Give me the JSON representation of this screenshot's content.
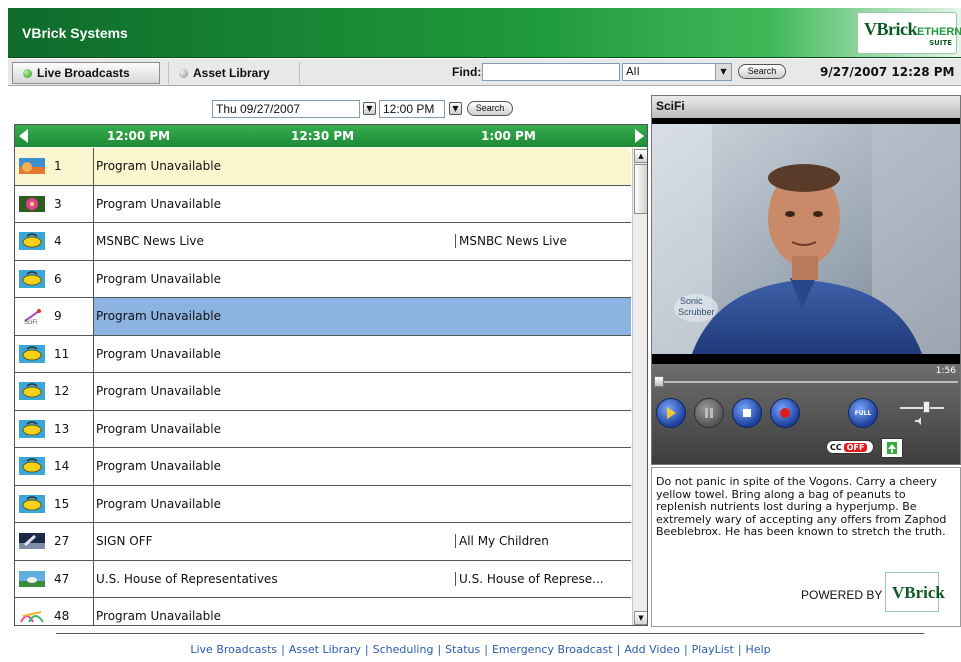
{
  "header": {
    "brand": "VBrick Systems",
    "logo_main": "VBrick",
    "logo_sub": "ETHERNETV",
    "logo_suite": "SUITE"
  },
  "nav": {
    "tabs": [
      {
        "label": "Live Broadcasts",
        "active": true
      },
      {
        "label": "Asset Library",
        "active": false
      }
    ],
    "find_label": "Find:",
    "find_value": "",
    "find_scope": "All",
    "search_button": "Search",
    "datetime": "9/27/2007 12:28 PM"
  },
  "guide": {
    "date": "Thu 09/27/2007",
    "time": "12:00 PM",
    "search_button": "Search",
    "time_slots": [
      "12:00 PM",
      "12:30 PM",
      "1:00 PM"
    ],
    "channels": [
      {
        "num": "1",
        "icon": "sunset-thumb-icon",
        "programs": [
          "Program Unavailable"
        ],
        "state": "highlight"
      },
      {
        "num": "3",
        "icon": "flower-thumb-icon",
        "programs": [
          "Program Unavailable"
        ],
        "state": ""
      },
      {
        "num": "4",
        "icon": "broadcast-icon",
        "programs": [
          "MSNBC News Live",
          "MSNBC News Live"
        ],
        "state": ""
      },
      {
        "num": "6",
        "icon": "broadcast-icon",
        "programs": [
          "Program Unavailable"
        ],
        "state": ""
      },
      {
        "num": "9",
        "icon": "scifi-logo-icon",
        "programs": [
          "Program Unavailable"
        ],
        "state": "selected"
      },
      {
        "num": "11",
        "icon": "broadcast-icon",
        "programs": [
          "Program Unavailable"
        ],
        "state": ""
      },
      {
        "num": "12",
        "icon": "broadcast-icon",
        "programs": [
          "Program Unavailable"
        ],
        "state": ""
      },
      {
        "num": "13",
        "icon": "broadcast-icon",
        "programs": [
          "Program Unavailable"
        ],
        "state": ""
      },
      {
        "num": "14",
        "icon": "broadcast-icon",
        "programs": [
          "Program Unavailable"
        ],
        "state": ""
      },
      {
        "num": "15",
        "icon": "broadcast-icon",
        "programs": [
          "Program Unavailable"
        ],
        "state": ""
      },
      {
        "num": "27",
        "icon": "satellite-thumb-icon",
        "programs": [
          "SIGN OFF",
          "All My Children"
        ],
        "state": ""
      },
      {
        "num": "47",
        "icon": "capitol-thumb-icon",
        "programs": [
          "U.S. House of Representatives",
          "U.S. House of Represe..."
        ],
        "state": ""
      },
      {
        "num": "48",
        "icon": "abstract-thumb-icon",
        "programs": [
          "Program Unavailable"
        ],
        "state": ""
      }
    ]
  },
  "player": {
    "channel_title": "SciFi",
    "time_code": "1:56",
    "cc_label": "CC",
    "cc_state": "OFF",
    "full_label": "FULL",
    "description": "Do not panic in spite of the Vogons. Carry a cheery yellow towel. Bring along a bag of peanuts to replenish nutrients lost during a hyperjump. Be extremely wary of accepting any offers from Zaphod Beeblebrox. He has been known to stretch the truth.",
    "powered_by": "POWERED BY",
    "vbrick_logo": "VBrick"
  },
  "footer": {
    "links": [
      "Live Broadcasts",
      "Asset Library",
      "Scheduling",
      "Status",
      "Emergency Broadcast",
      "Add Video",
      "PlayList",
      "Help"
    ]
  },
  "colors": {
    "brand_green": "#1f9a3b",
    "selected_row": "#8db3e2",
    "highlight_row": "#fbf6cf",
    "link_blue": "#2a5db0"
  }
}
